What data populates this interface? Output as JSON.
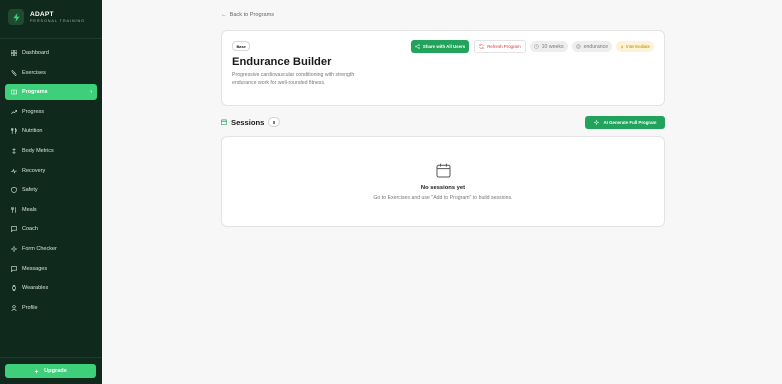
{
  "brand": {
    "name": "ADAPT",
    "subtitle": "PERSONAL TRAINING",
    "logo_icon": "bolt-icon"
  },
  "sidebar": {
    "items": [
      {
        "label": "Dashboard",
        "icon": "grid-icon",
        "active": false
      },
      {
        "label": "Exercises",
        "icon": "dumbbell-icon",
        "active": false
      },
      {
        "label": "Programs",
        "icon": "book-icon",
        "active": true
      },
      {
        "label": "Progress",
        "icon": "trend-icon",
        "active": false
      },
      {
        "label": "Nutrition",
        "icon": "utensils-icon",
        "active": false
      },
      {
        "label": "Body Metrics",
        "icon": "scale-icon",
        "active": false
      },
      {
        "label": "Recovery",
        "icon": "pulse-icon",
        "active": false
      },
      {
        "label": "Safety",
        "icon": "shield-icon",
        "active": false
      },
      {
        "label": "Meals",
        "icon": "fork-icon",
        "active": false
      },
      {
        "label": "Coach",
        "icon": "chat-icon",
        "active": false
      },
      {
        "label": "Form Checker",
        "icon": "sparkle-icon",
        "active": false
      },
      {
        "label": "Messages",
        "icon": "message-icon",
        "active": false
      },
      {
        "label": "Wearables",
        "icon": "watch-icon",
        "active": false
      },
      {
        "label": "Profile",
        "icon": "user-icon",
        "active": false
      }
    ],
    "upgrade_label": "Upgrade"
  },
  "main": {
    "back_label": "Back to Programs",
    "program": {
      "badge": "Base",
      "title": "Endurance Builder",
      "description": "Progressive cardiovascular conditioning with strength endurance work for well-rounded fitness.",
      "share_label": "Share with All Users",
      "refresh_label": "Refresh Program",
      "duration": "10 weeks",
      "focus": "endurance",
      "level": "Intermediate"
    },
    "sessions": {
      "title": "Sessions",
      "count": "0",
      "ai_button_label": "AI Generate Full Program",
      "empty_title": "No sessions yet",
      "empty_hint": "Go to Exercises and use \"Add to Program\" to build sessions."
    }
  },
  "colors": {
    "sidebar_bg": "#0f2a1c",
    "accent": "#3ecf7a",
    "primary_button": "#21a35b",
    "danger": "#d63b3b",
    "level_badge": "#fdf3d6"
  }
}
